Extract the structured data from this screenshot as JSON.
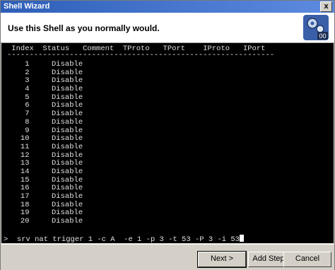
{
  "window": {
    "title": "Shell Wizard",
    "close_label": "x"
  },
  "header": {
    "message": "Use this Shell as you normally would.",
    "logo_text": "00"
  },
  "terminal": {
    "columns_header": " Index  Status   Comment  TProto   TPort    IProto   IPort",
    "separator": "------------------------------------------------------------",
    "rows": [
      "    1     Disable",
      "    2     Disable",
      "    3     Disable",
      "    4     Disable",
      "    5     Disable",
      "    6     Disable",
      "    7     Disable",
      "    8     Disable",
      "    9     Disable",
      "   10     Disable",
      "   11     Disable",
      "   12     Disable",
      "   13     Disable",
      "   14     Disable",
      "   15     Disable",
      "   16     Disable",
      "   17     Disable",
      "   18     Disable",
      "   19     Disable",
      "   20     Disable"
    ],
    "prompt_symbol": ">",
    "command": "  srv nat trigger 1 -c A  -e 1 -p 3 -t 53 -P 3 -i 53"
  },
  "footer": {
    "next_label": "Next >",
    "add_step_label": "Add Step",
    "cancel_label": "Cancel"
  }
}
